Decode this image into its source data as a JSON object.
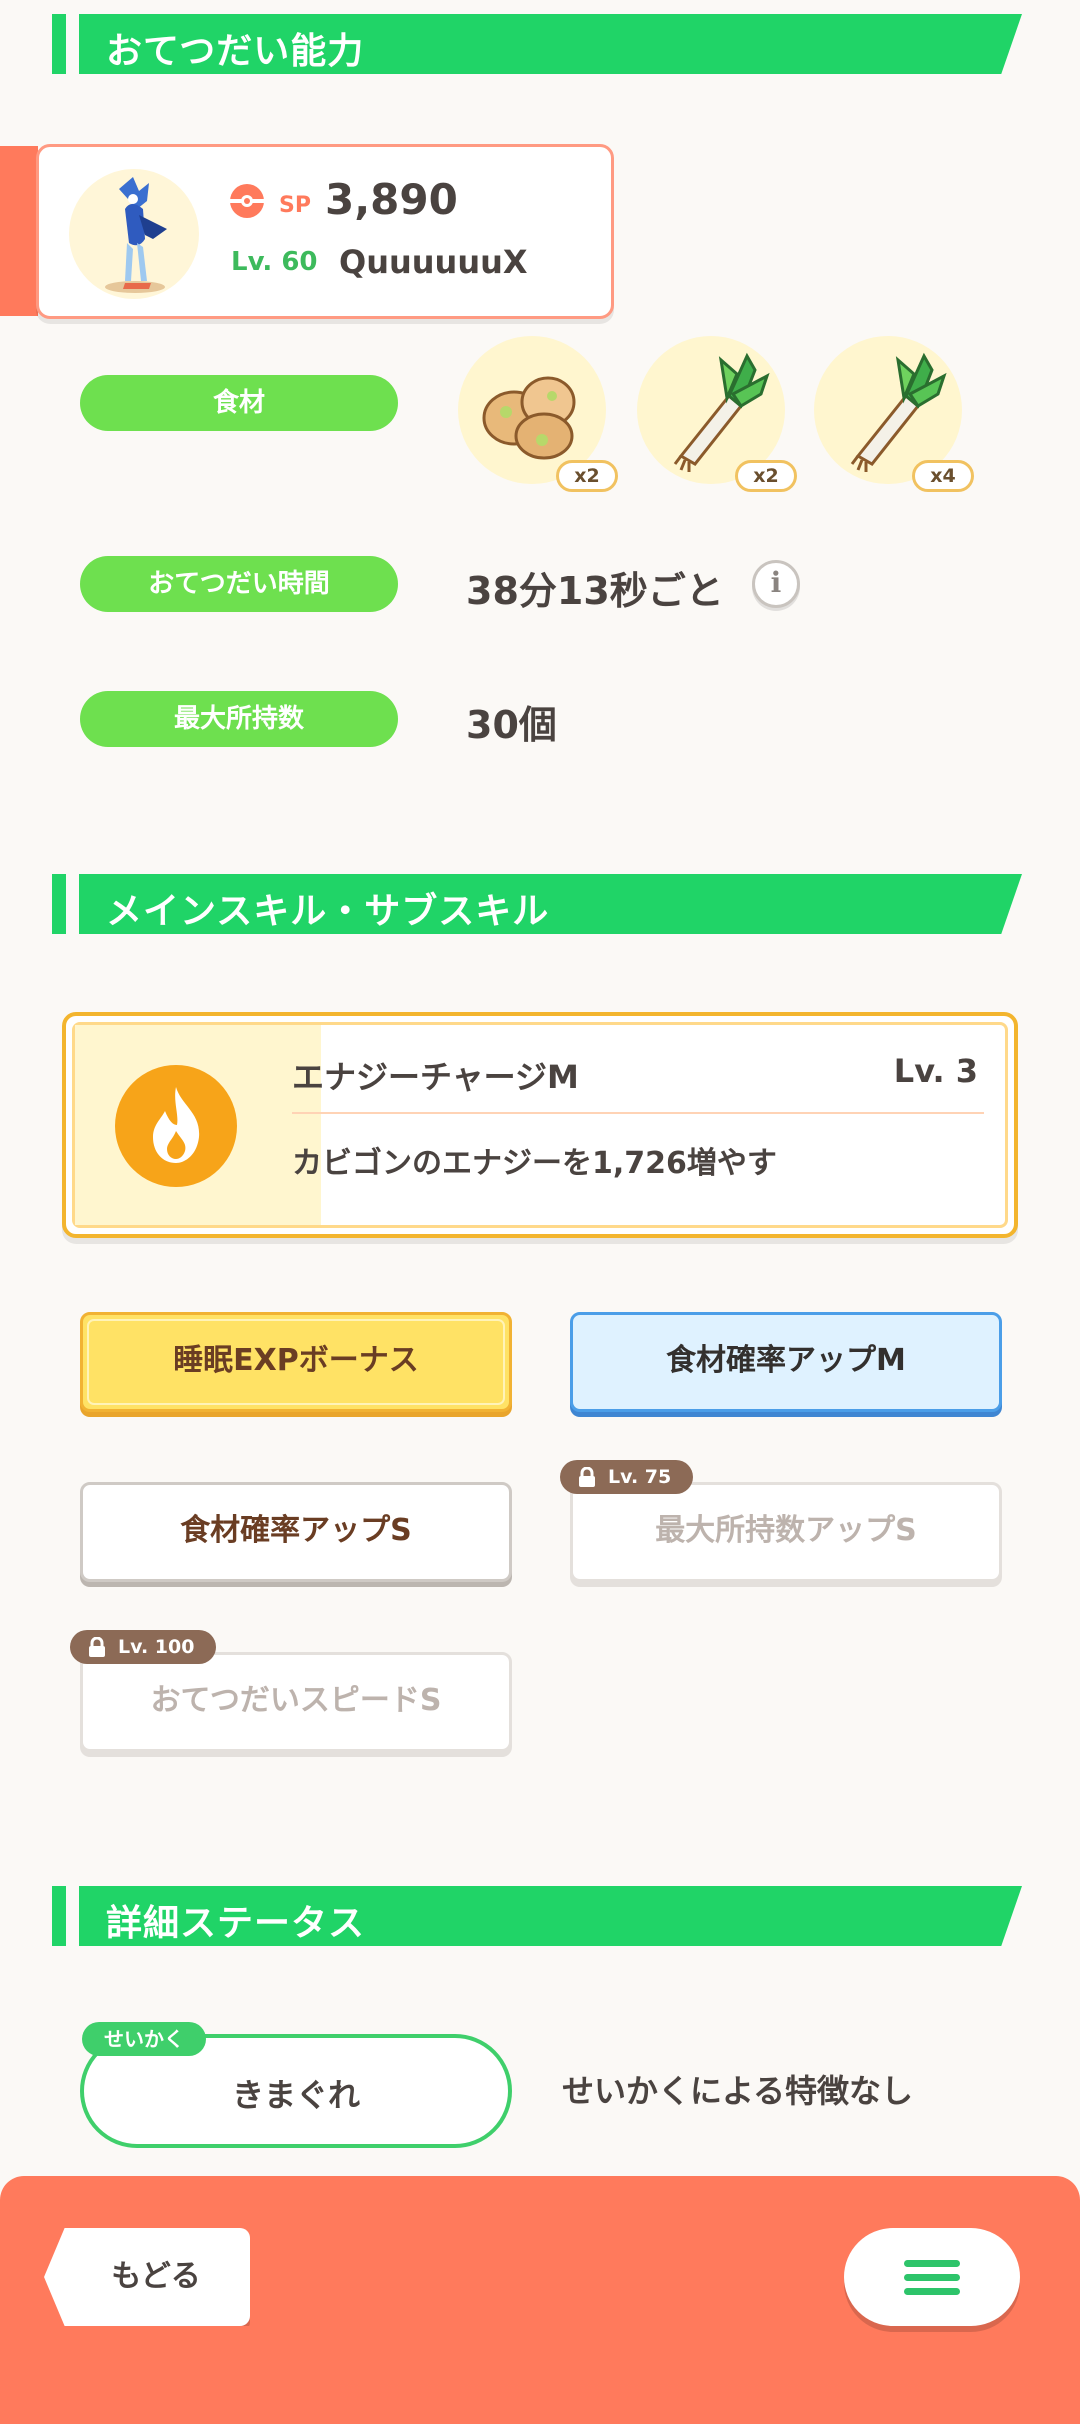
{
  "sections": {
    "help_ability": "おてつだい能力",
    "skills": "メインスキル・サブスキル",
    "details": "詳細ステータス"
  },
  "pokemon": {
    "sp_label": "SP",
    "sp_value": "3,890",
    "level": "Lv. 60",
    "nickname": "QuuuuuuX"
  },
  "ingredients": {
    "label": "食材",
    "items": [
      {
        "icon": "potato-icon",
        "count": "x2"
      },
      {
        "icon": "leek-icon",
        "count": "x2"
      },
      {
        "icon": "leek-icon",
        "count": "x4"
      }
    ]
  },
  "help_time": {
    "label": "おてつだい時間",
    "value": "38分13秒ごと"
  },
  "max_carry": {
    "label": "最大所持数",
    "value": "30個"
  },
  "main_skill": {
    "name": "エナジーチャージM",
    "level": "Lv. 3",
    "description": "カビゴンのエナジーを1,726増やす"
  },
  "sub_skills": [
    {
      "label": "睡眠EXPボーナス",
      "style": "gold"
    },
    {
      "label": "食材確率アップM",
      "style": "blue"
    },
    {
      "label": "食材確率アップS",
      "style": "white"
    },
    {
      "label": "最大所持数アップS",
      "style": "locked",
      "lock_level": "Lv. 75"
    },
    {
      "label": "おてつだいスピードS",
      "style": "locked",
      "lock_level": "Lv. 100"
    }
  ],
  "nature": {
    "tag": "せいかく",
    "value": "きまぐれ",
    "description": "せいかくによる特徴なし"
  },
  "footer": {
    "back_label": "もどる"
  }
}
